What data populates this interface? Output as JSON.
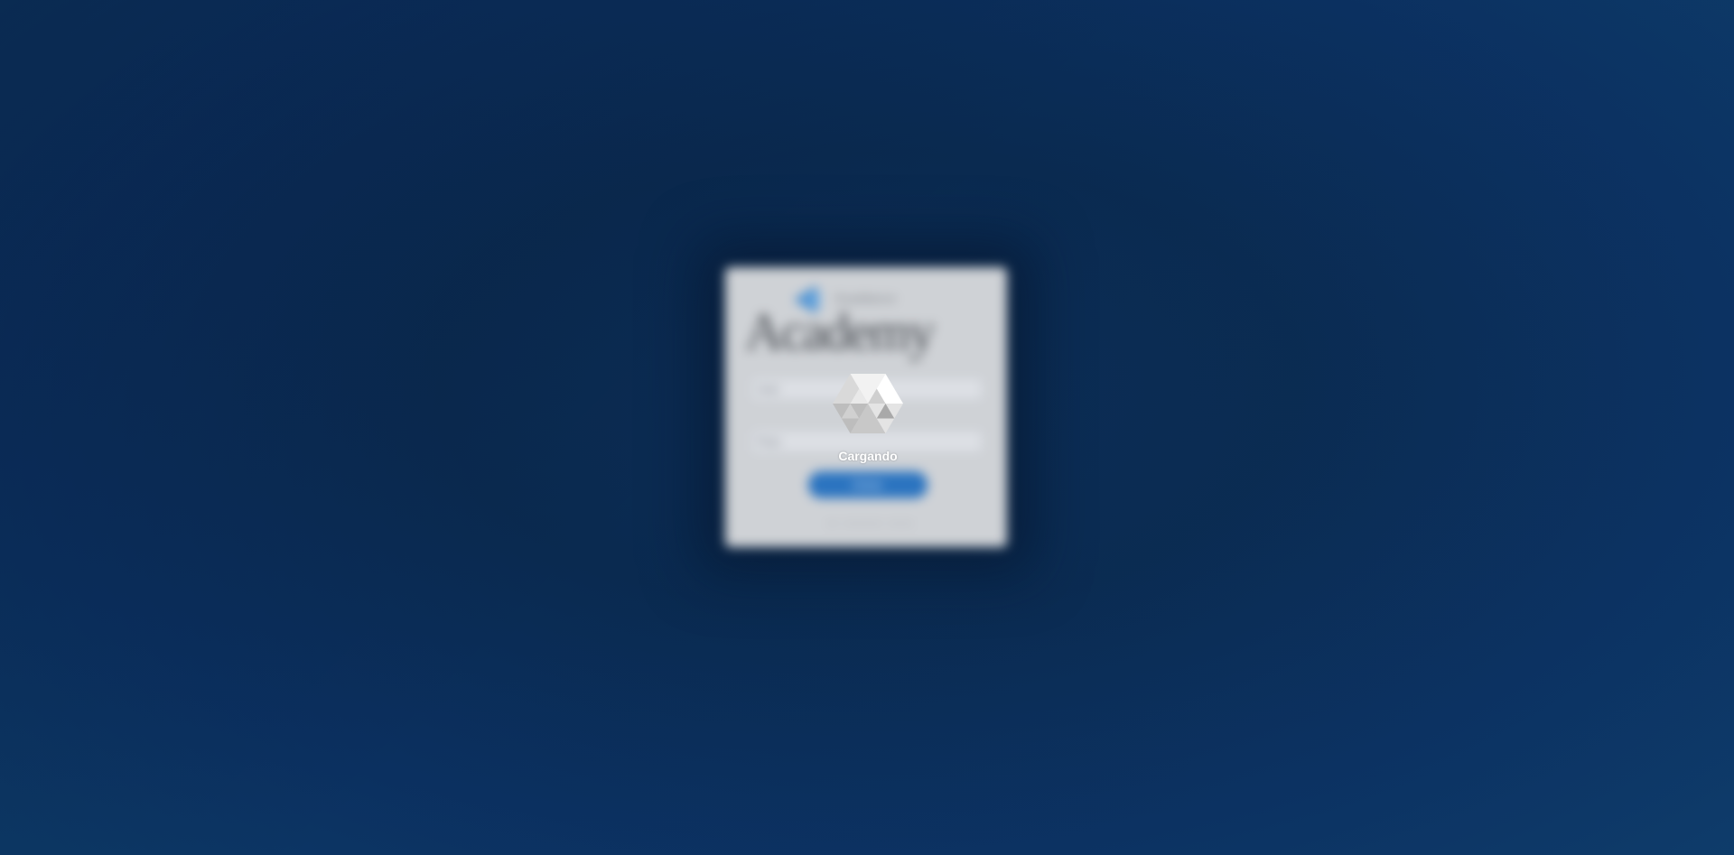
{
  "login": {
    "logo_small_text": "RoadWarrior",
    "logo_big_text": "Academy",
    "username_label": "User",
    "password_label": "Pass",
    "submit_label": "Entrar",
    "footer_text": "— · — — — · — —"
  },
  "loader": {
    "text": "Cargando",
    "icon": "hexagon-spinner-icon"
  },
  "colors": {
    "background": "#0b2d56",
    "card": "#cfd2d6",
    "button": "#2b74c0",
    "loader_text": "#ffffff"
  }
}
